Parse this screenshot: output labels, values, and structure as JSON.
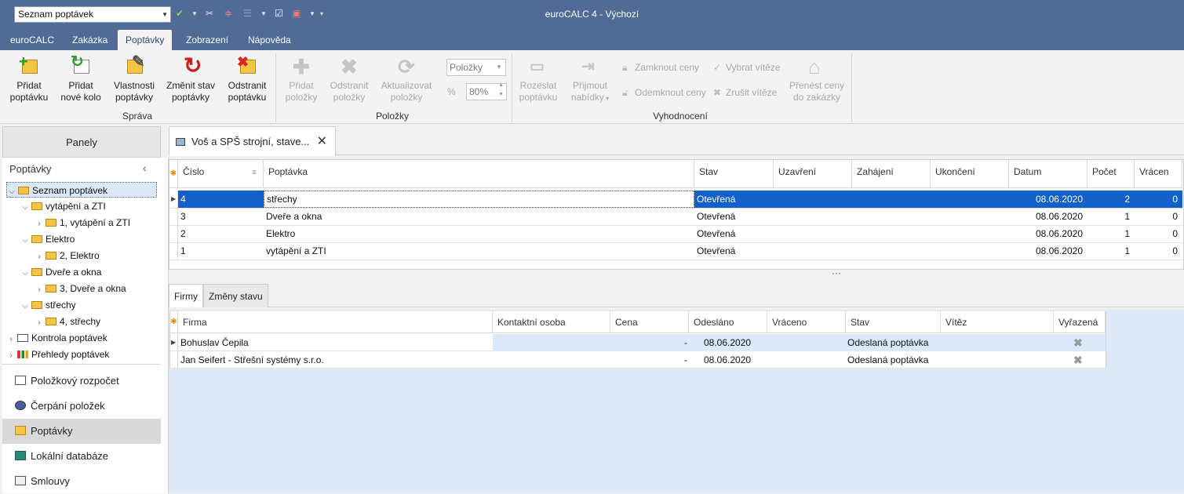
{
  "titlebar": {
    "quick_select": "Seznam poptávek",
    "app_title": "euroCALC 4 - Výchozí"
  },
  "menu": [
    "euroCALC",
    "Zakázka",
    "Poptávky",
    "Zobrazení",
    "Nápověda"
  ],
  "ribbon": {
    "sprava": {
      "label": "Správa",
      "pridat_poptavku": [
        "Přidat",
        "poptávku"
      ],
      "pridat_kolo": [
        "Přidat",
        "nové kolo"
      ],
      "vlastnosti": [
        "Vlastnosti",
        "poptávky"
      ],
      "zmenit_stav": [
        "Změnit stav",
        "poptávky"
      ],
      "odstranit_poptavku": [
        "Odstranit",
        "poptávku"
      ]
    },
    "polozky": {
      "label": "Položky",
      "pridat": [
        "Přidat",
        "položky"
      ],
      "odstranit": [
        "Odstranit",
        "položky"
      ],
      "aktualizovat": [
        "Aktualizovat",
        "položky"
      ],
      "combo_value": "Položky",
      "percent_value": "80%"
    },
    "vyhodnoceni": {
      "label": "Vyhodnocení",
      "rozeslat": [
        "Rozeslat",
        "poptávku"
      ],
      "prijmout": [
        "Přijmout",
        "nabídky"
      ],
      "zamknout": "Zamknout ceny",
      "odemknout": "Odemknout ceny",
      "vybrat": "Vybrat vítěze",
      "zrusit": "Zrušit vítěze",
      "prenest": [
        "Přenést ceny",
        "do zakázky"
      ]
    }
  },
  "left": {
    "panely": "Panely",
    "header": "Poptávky",
    "tree": [
      "Seznam poptávek",
      "vytápění a ZTI",
      "1, vytápění a ZTI",
      "Elektro",
      "2, Elektro",
      "Dveře a okna",
      "3, Dveře a okna",
      "střechy",
      "4, střechy",
      "Kontrola poptávek",
      "Přehledy poptávek"
    ],
    "nav": [
      "Položkový rozpočet",
      "Čerpání položek",
      "Poptávky",
      "Lokální databáze",
      "Smlouvy"
    ]
  },
  "doc_tab": "Voš a SPŠ strojní, stave...",
  "grid1": {
    "headers": [
      "Číslo",
      "Poptávka",
      "Stav",
      "Uzavření",
      "Zahájení",
      "Ukončení",
      "Datum",
      "Počet",
      "Vrácen"
    ],
    "rows": [
      {
        "cislo": "4",
        "poptavka": "střechy",
        "stav": "Otevřená",
        "datum": "08.06.2020",
        "pocet": "2",
        "vracen": "0"
      },
      {
        "cislo": "3",
        "poptavka": "Dveře a okna",
        "stav": "Otevřená",
        "datum": "08.06.2020",
        "pocet": "1",
        "vracen": "0"
      },
      {
        "cislo": "2",
        "poptavka": "Elektro",
        "stav": "Otevřená",
        "datum": "08.06.2020",
        "pocet": "1",
        "vracen": "0"
      },
      {
        "cislo": "1",
        "poptavka": "vytápění a ZTI",
        "stav": "Otevřená",
        "datum": "08.06.2020",
        "pocet": "1",
        "vracen": "0"
      }
    ]
  },
  "bottom_tabs": [
    "Firmy",
    "Změny stavu"
  ],
  "grid2": {
    "headers": [
      "Firma",
      "Kontaktní osoba",
      "Cena",
      "Odesláno",
      "Vráceno",
      "Stav",
      "Vítěz",
      "Vyřazená"
    ],
    "rows": [
      {
        "firma": "Bohuslav Čepila",
        "cena": "-",
        "odeslano": "08.06.2020",
        "stav": "Odeslaná poptávka"
      },
      {
        "firma": "Jan Seifert - Střešní systémy s.r.o.",
        "cena": "-",
        "odeslano": "08.06.2020",
        "stav": "Odeslaná poptávka"
      }
    ]
  }
}
